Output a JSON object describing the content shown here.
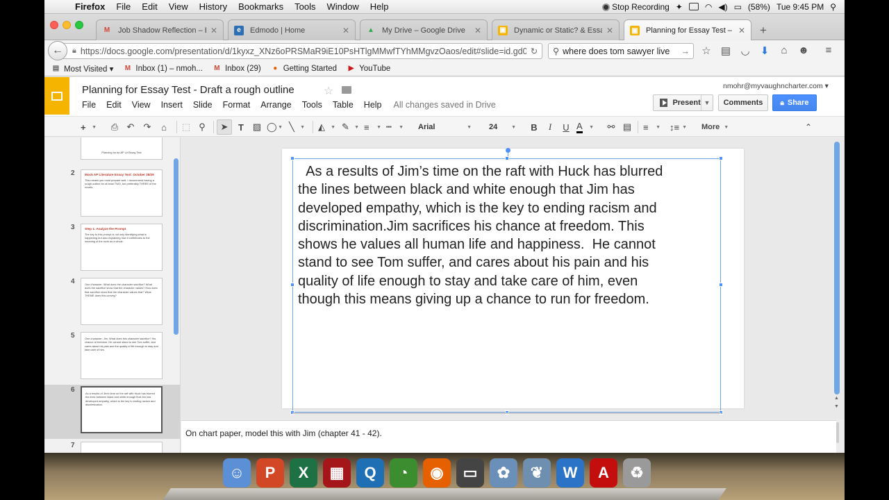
{
  "menubar": {
    "app": "Firefox",
    "items": [
      "File",
      "Edit",
      "View",
      "History",
      "Bookmarks",
      "Tools",
      "Window",
      "Help"
    ],
    "stop_recording": "Stop Recording",
    "battery": "(58%)",
    "clock": "Tue 9:45 PM"
  },
  "tabs": [
    {
      "label": "Job Shadow Reflection – E...",
      "favicon": "M",
      "color": "#d44638",
      "bg": "transparent"
    },
    {
      "label": "Edmodo | Home",
      "favicon": "e",
      "color": "#ffffff",
      "bg": "#2d6fb5"
    },
    {
      "label": "My Drive – Google Drive",
      "favicon": "▲",
      "color": "#34a853",
      "bg": "transparent"
    },
    {
      "label": "Dynamic or Static? & Essa...",
      "favicon": "▣",
      "color": "#ffffff",
      "bg": "#f4b400"
    },
    {
      "label": "Planning for Essay Test – ...",
      "favicon": "▣",
      "color": "#ffffff",
      "bg": "#f4b400"
    }
  ],
  "navbar": {
    "url": "https://docs.google.com/presentation/d/1kyxz_XNz6oPRSMaR9iE10PsHTlgMMwfTYhMMgvzOaos/edit#slide=id.gd0",
    "search": "where does tom sawyer live"
  },
  "bookmarks": [
    {
      "label": "Most Visited ▾",
      "icon": "▤",
      "color": "#666"
    },
    {
      "label": "Inbox (1) – nmoh...",
      "icon": "M",
      "color": "#d44638"
    },
    {
      "label": "Inbox (29)",
      "icon": "M",
      "color": "#d44638"
    },
    {
      "label": "Getting Started",
      "icon": "●",
      "color": "#e66000"
    },
    {
      "label": "YouTube",
      "icon": "▶",
      "color": "#cc181e"
    }
  ],
  "doc": {
    "title": "Planning for Essay Test - Draft a rough outline",
    "menu": [
      "File",
      "Edit",
      "View",
      "Insert",
      "Slide",
      "Format",
      "Arrange",
      "Tools",
      "Table",
      "Help"
    ],
    "saved_status": "All changes saved in Drive",
    "user_email": "nmohr@myvaughncharter.com ▾",
    "present_label": "Present",
    "comments_label": "Comments",
    "share_label": "Share"
  },
  "toolbar": {
    "font": "Arial",
    "size": "24",
    "more": "More"
  },
  "slides": [
    {
      "num": "",
      "title": "",
      "text": "Planning for an AP Lit Essay Test"
    },
    {
      "num": "2",
      "title": "Mock AP Literature Essay Test: October 28/29",
      "text": "This means you must prepare well. I recommend having a rough outline for at least TWO, but preferably THREE of the novels."
    },
    {
      "num": "3",
      "title": "Step 1: Analyze the Prompt",
      "text": "The key to this prompt is not only identifying what is happening but also explaining how it contributes to the meaning of the work as a whole."
    },
    {
      "num": "4",
      "title": "",
      "text": "One character: What does the character sacrifice? What does the sacrifice show that the character values? How does that sacrifice show that the character values that? What THEME does this convey?"
    },
    {
      "num": "5",
      "title": "",
      "text": "One character: Jim. What does this character sacrifice? His chance at freedom. He cannot stand to see Tom suffer, and cares about his pain and the quality of life enough to stay and take care of him."
    },
    {
      "num": "6",
      "title": "",
      "text": "As a results of Jim's time on the raft with Huck has blurred the lines between black and white enough that Jim has developed empathy, which is the key to ending racism and discrimination."
    },
    {
      "num": "7",
      "title": "",
      "text": ""
    }
  ],
  "slide_body": "  As a results of Jim’s time on the raft with Huck has blurred\nthe lines between black and white enough that Jim has\ndeveloped empathy, which is the key to ending racism and\ndiscrimination.Jim sacrifices his chance at freedom. This\nshows he values all human life and happiness.  He cannot\nstand to see Tom suffer, and cares about his pain and his\nquality of life enough to stay and take care of him, even\nthough this means giving up a chance to run for freedom.",
  "speaker_notes": "On chart paper, model this with Jim (chapter 41 - 42).",
  "dock_apps": [
    {
      "name": "finder",
      "glyph": "☺",
      "bg": "#5b8fd6"
    },
    {
      "name": "powerpoint",
      "glyph": "P",
      "bg": "#d24726"
    },
    {
      "name": "excel",
      "glyph": "X",
      "bg": "#1e7145"
    },
    {
      "name": "photobooth",
      "glyph": "▦",
      "bg": "#a4161a"
    },
    {
      "name": "quicktime",
      "glyph": "Q",
      "bg": "#1f6fb5"
    },
    {
      "name": "time-machine",
      "glyph": "◔",
      "bg": "#3c8d2f"
    },
    {
      "name": "firefox",
      "glyph": "◉",
      "bg": "#e66000"
    },
    {
      "name": "printer",
      "glyph": "▭",
      "bg": "#444444"
    },
    {
      "name": "iphoto",
      "glyph": "✿",
      "bg": "#6a8fb8"
    },
    {
      "name": "preview",
      "glyph": "❦",
      "bg": "#6f8fb0"
    },
    {
      "name": "word",
      "glyph": "W",
      "bg": "#2b73c6"
    },
    {
      "name": "acrobat",
      "glyph": "A",
      "bg": "#c40e0e"
    },
    {
      "name": "trash",
      "glyph": "♻",
      "bg": "#9a9a9a"
    }
  ]
}
